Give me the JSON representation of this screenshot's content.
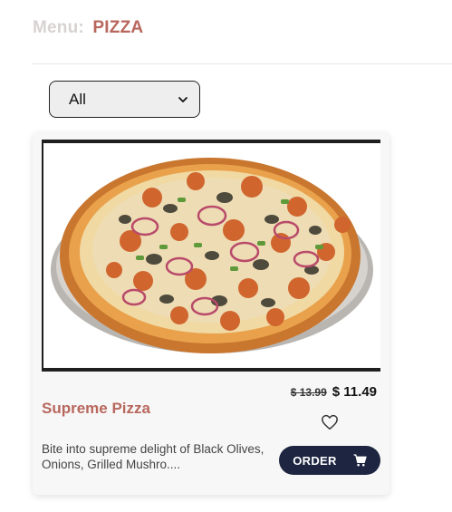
{
  "header": {
    "prefix": "Menu:",
    "category": "PIZZA"
  },
  "filter": {
    "selected": "All"
  },
  "product": {
    "name": "Supreme Pizza",
    "old_price": "$ 13.99",
    "new_price": "$ 11.49",
    "description": "Bite into supreme delight of Black Olives, Onions, Grilled Mushro....",
    "order_label": "ORDER"
  },
  "icons": {
    "dropdown": "chevron-down-icon",
    "favorite": "heart-outline-icon",
    "cart": "cart-icon"
  },
  "colors": {
    "accent": "#b8675d",
    "button": "#1d2540"
  }
}
